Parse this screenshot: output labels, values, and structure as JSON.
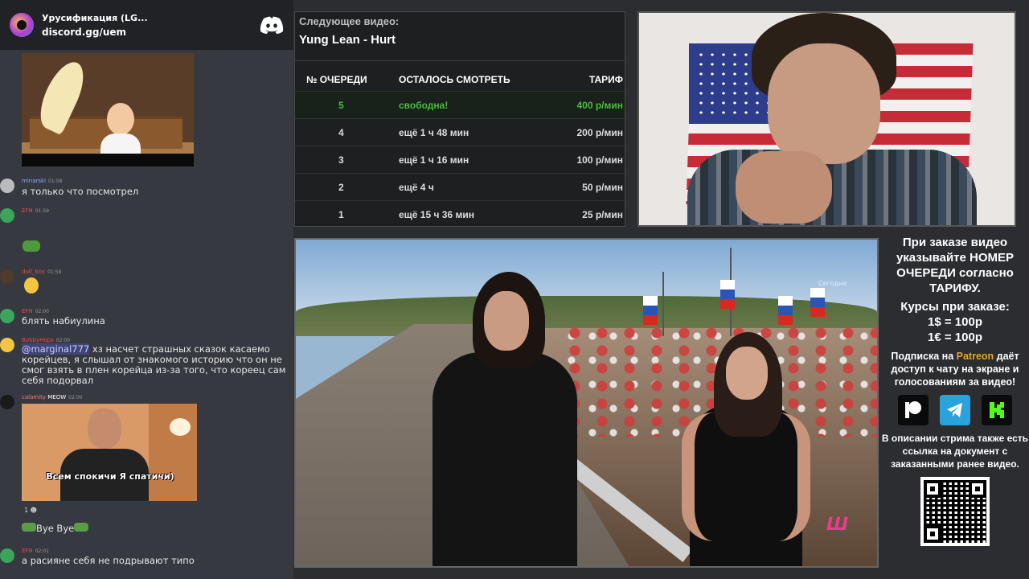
{
  "chat": {
    "server_name": "Урусификация (LG...",
    "invite_link": "discord.gg/uem",
    "messages": [
      {
        "user": "minarski",
        "time": "01:58",
        "text": "я только что посмотрел",
        "user_color": "#9aa8ff"
      },
      {
        "user": "EFN",
        "time": "01:59",
        "text": "",
        "user_color": "#e84d4d"
      },
      {
        "user": "dull_boy",
        "time": "01:59",
        "text": "",
        "user_color": "#e84d4d"
      },
      {
        "user": "EFN",
        "time": "02:00",
        "text": "блять набиулина",
        "user_color": "#e84d4d"
      },
      {
        "user": "BobbyHops",
        "time": "02:00",
        "mention": "@marginal777",
        "text": " хз насчет страшных сказок касаемо корейцев, я слышал от знакомого историю что он не смог взять в плен корейца из-за того, что кореец сам себя подорвал",
        "user_color": "#e84d4d"
      },
      {
        "user": "calamity",
        "badge": "MEOW",
        "time": "02:00",
        "text": "",
        "user_color": "#ff7b7b"
      },
      {
        "user": "",
        "time": "",
        "text": "Bye Bye",
        "user_color": "#ffffff"
      },
      {
        "user": "EFN",
        "time": "02:01",
        "text": "а расияне себя не подрывают типо",
        "user_color": "#e84d4d"
      }
    ],
    "gif_caption": "Всем спокичи Я спатичи)",
    "reaction_count": "1"
  },
  "queue": {
    "next_label": "Следующее видео:",
    "next_title": "Yung Lean - Hurt",
    "headers": {
      "col1": "№ ОЧЕРЕДИ",
      "col2": "ОСТАЛОСЬ СМОТРЕТЬ",
      "col3": "ТАРИФ"
    },
    "rows": [
      {
        "num": "5",
        "remaining": "свободна!",
        "rate": "400 р/мин",
        "free": true
      },
      {
        "num": "4",
        "remaining": "ещё 1 ч 48 мин",
        "rate": "200 р/мин",
        "free": false
      },
      {
        "num": "3",
        "remaining": "ещё 1 ч 16 мин",
        "rate": "100 р/мин",
        "free": false
      },
      {
        "num": "2",
        "remaining": "ещё 4 ч",
        "rate": "50 р/мин",
        "free": false
      },
      {
        "num": "1",
        "remaining": "ещё 15 ч 36 мин",
        "rate": "25 р/мин",
        "free": false
      }
    ]
  },
  "video": {
    "watermark": "Сегодня",
    "channel_logo": "Ш"
  },
  "info": {
    "order_text": "При заказе видео указывайте НОМЕР ОЧЕРЕДИ согласно ТАРИФУ.",
    "rates_title": "Курсы при заказе:",
    "rate_usd": "1$ = 100р",
    "rate_eur": "1€ = 100р",
    "sub_before": "Подписка на ",
    "sub_brand": "Patreon",
    "sub_after": " даёт доступ к чату на экране и голосованиям за видео!",
    "description": "В описании стрима также есть ссылка на документ с заказанными ранее видео.",
    "icons": [
      "patreon-icon",
      "telegram-icon",
      "kick-icon"
    ],
    "colors": {
      "patreon": "#e4a23a",
      "free_slot": "#4cbb3f",
      "telegram": "#2aa2db",
      "kick": "#53fc18"
    }
  }
}
